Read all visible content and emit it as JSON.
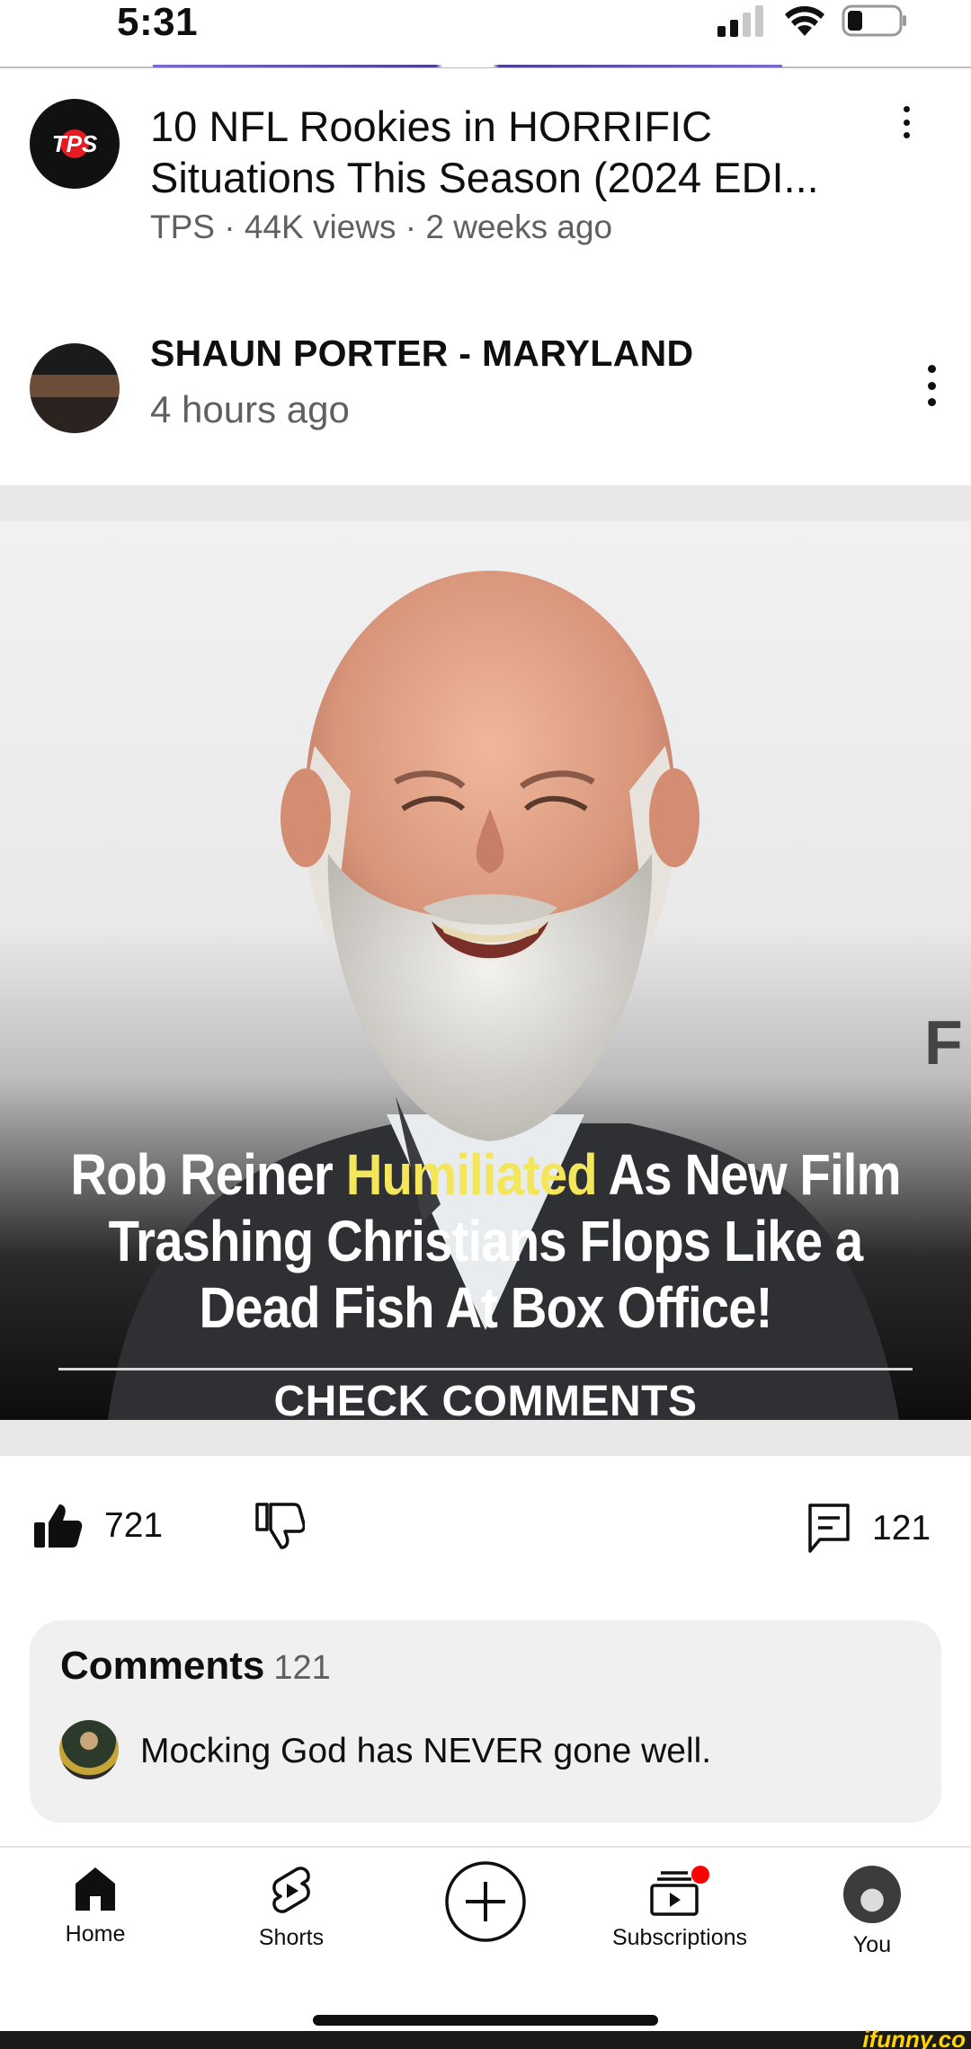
{
  "status_bar": {
    "time": "5:31"
  },
  "recommended_video": {
    "channel_avatar_text": "TPS",
    "title": "10 NFL Rookies in HORRIFIC Situations This Season (2024 EDI...",
    "meta": "TPS · 44K views · 2 weeks ago"
  },
  "post": {
    "author": "SHAUN PORTER - MARYLAND",
    "time": "4 hours ago",
    "image": {
      "headline_before": "Rob Reiner ",
      "headline_highlight": "Humiliated",
      "headline_after": " As New Film Trashing Christians Flops Like a Dead Fish At Box Office!",
      "subtext": "CHECK COMMENTS",
      "side_letter": "F",
      "highlight_color": "#f3e65a"
    },
    "likes": "721",
    "comment_count": "121"
  },
  "comments": {
    "title": "Comments",
    "count": "121",
    "top_comment": "Mocking God has NEVER gone well."
  },
  "nav": {
    "home": "Home",
    "shorts": "Shorts",
    "subscriptions": "Subscriptions",
    "you": "You",
    "notification_color": "#ff0000"
  },
  "watermark": "ifunny.co"
}
